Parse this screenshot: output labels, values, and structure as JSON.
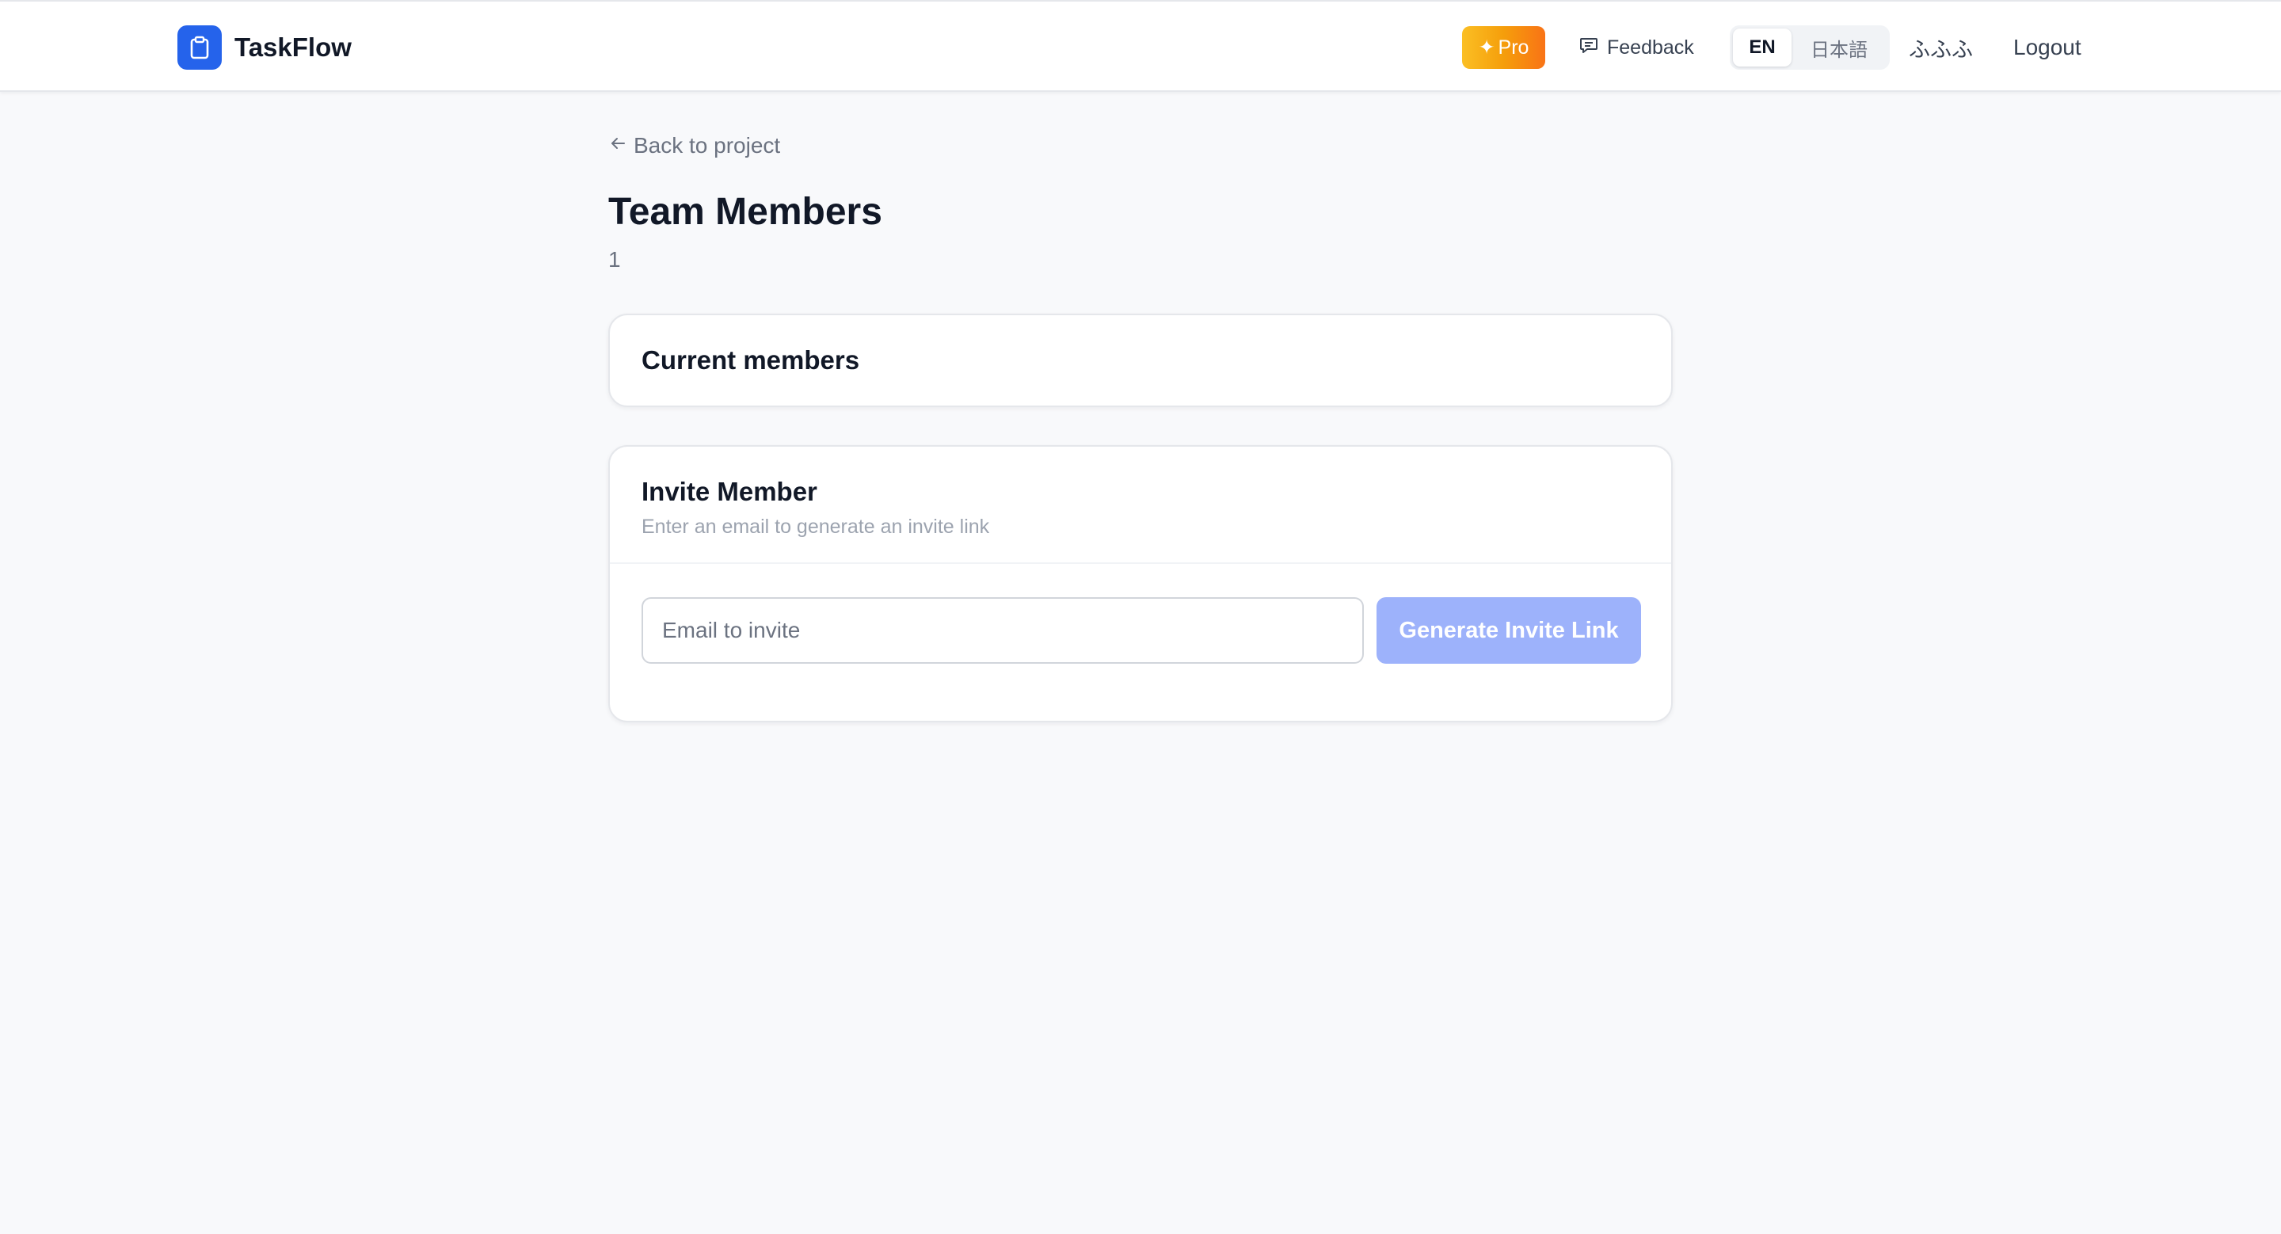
{
  "app": {
    "name": "TaskFlow",
    "brand_color": "#2563eb"
  },
  "header": {
    "pro_label": "Pro",
    "pro_icon": "sparkle-icon",
    "feedback_label": "Feedback",
    "feedback_icon": "message-square-icon",
    "languages": {
      "active": "EN",
      "inactive": "日本語"
    },
    "username": "ふふふ",
    "logout_label": "Logout"
  },
  "page": {
    "back_label": "Back to project",
    "back_icon": "arrow-left-icon",
    "title": "Team Members",
    "member_count": "1"
  },
  "members_card": {
    "title": "Current members"
  },
  "invite_card": {
    "title": "Invite Member",
    "description": "Enter an email to generate an invite link",
    "email_value": "",
    "email_placeholder": "Email to invite",
    "button_label": "Generate Invite Link",
    "button_color": "#9db2fb"
  }
}
